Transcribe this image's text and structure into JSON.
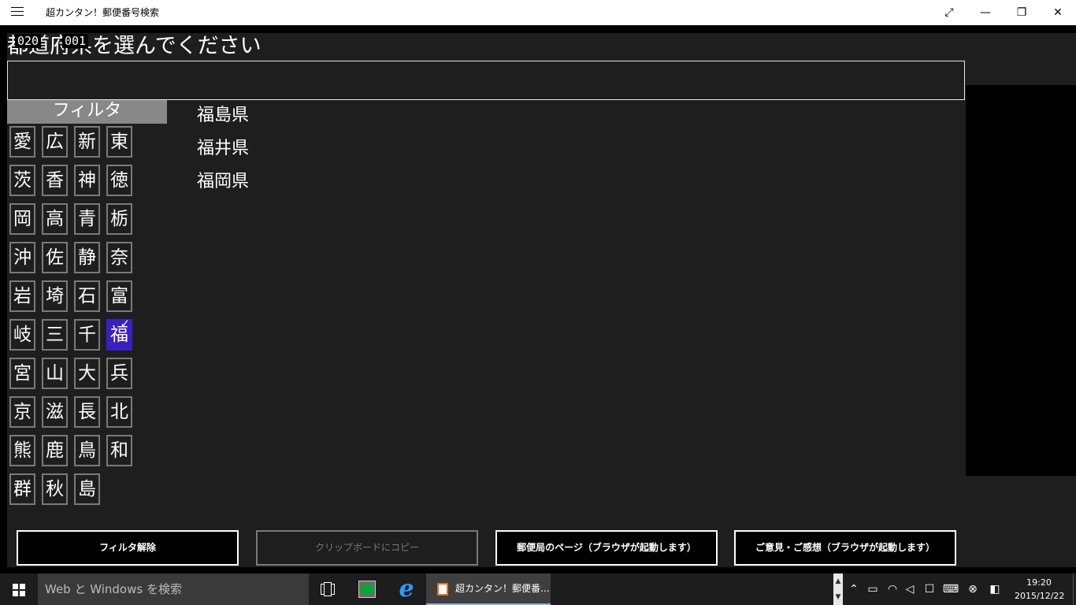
{
  "window": {
    "title": "超カンタン！郵便番号検索",
    "icons": [
      "hamburger-icon",
      "fullscreen-icon",
      "minimize-icon",
      "restore-icon",
      "close-icon"
    ]
  },
  "debug": {
    "left": "020",
    "right": "001"
  },
  "page": {
    "title": "都道府県を選んでください",
    "search_value": ""
  },
  "filter": {
    "header": "フィルタ",
    "selected": "福",
    "buttons": [
      "愛",
      "広",
      "新",
      "東",
      "茨",
      "香",
      "神",
      "徳",
      "岡",
      "高",
      "青",
      "栃",
      "沖",
      "佐",
      "静",
      "奈",
      "岩",
      "埼",
      "石",
      "富",
      "岐",
      "三",
      "千",
      "福",
      "宮",
      "山",
      "大",
      "兵",
      "京",
      "滋",
      "長",
      "北",
      "熊",
      "鹿",
      "鳥",
      "和",
      "群",
      "秋",
      "島"
    ]
  },
  "results": [
    "福島県",
    "福井県",
    "福岡県"
  ],
  "actions": {
    "clear_filter": "フィルタ解除",
    "copy_clipboard": "クリップボードにコピー",
    "post_office_page": "郵便局のページ（ブラウザが起動します）",
    "feedback": "ご意見・ご感想（ブラウザが起動します）"
  },
  "taskbar": {
    "search_placeholder": "Web と Windows を検索",
    "active_app": "超カンタン！郵便番...",
    "time": "19:20",
    "date": "2015/12/22"
  }
}
